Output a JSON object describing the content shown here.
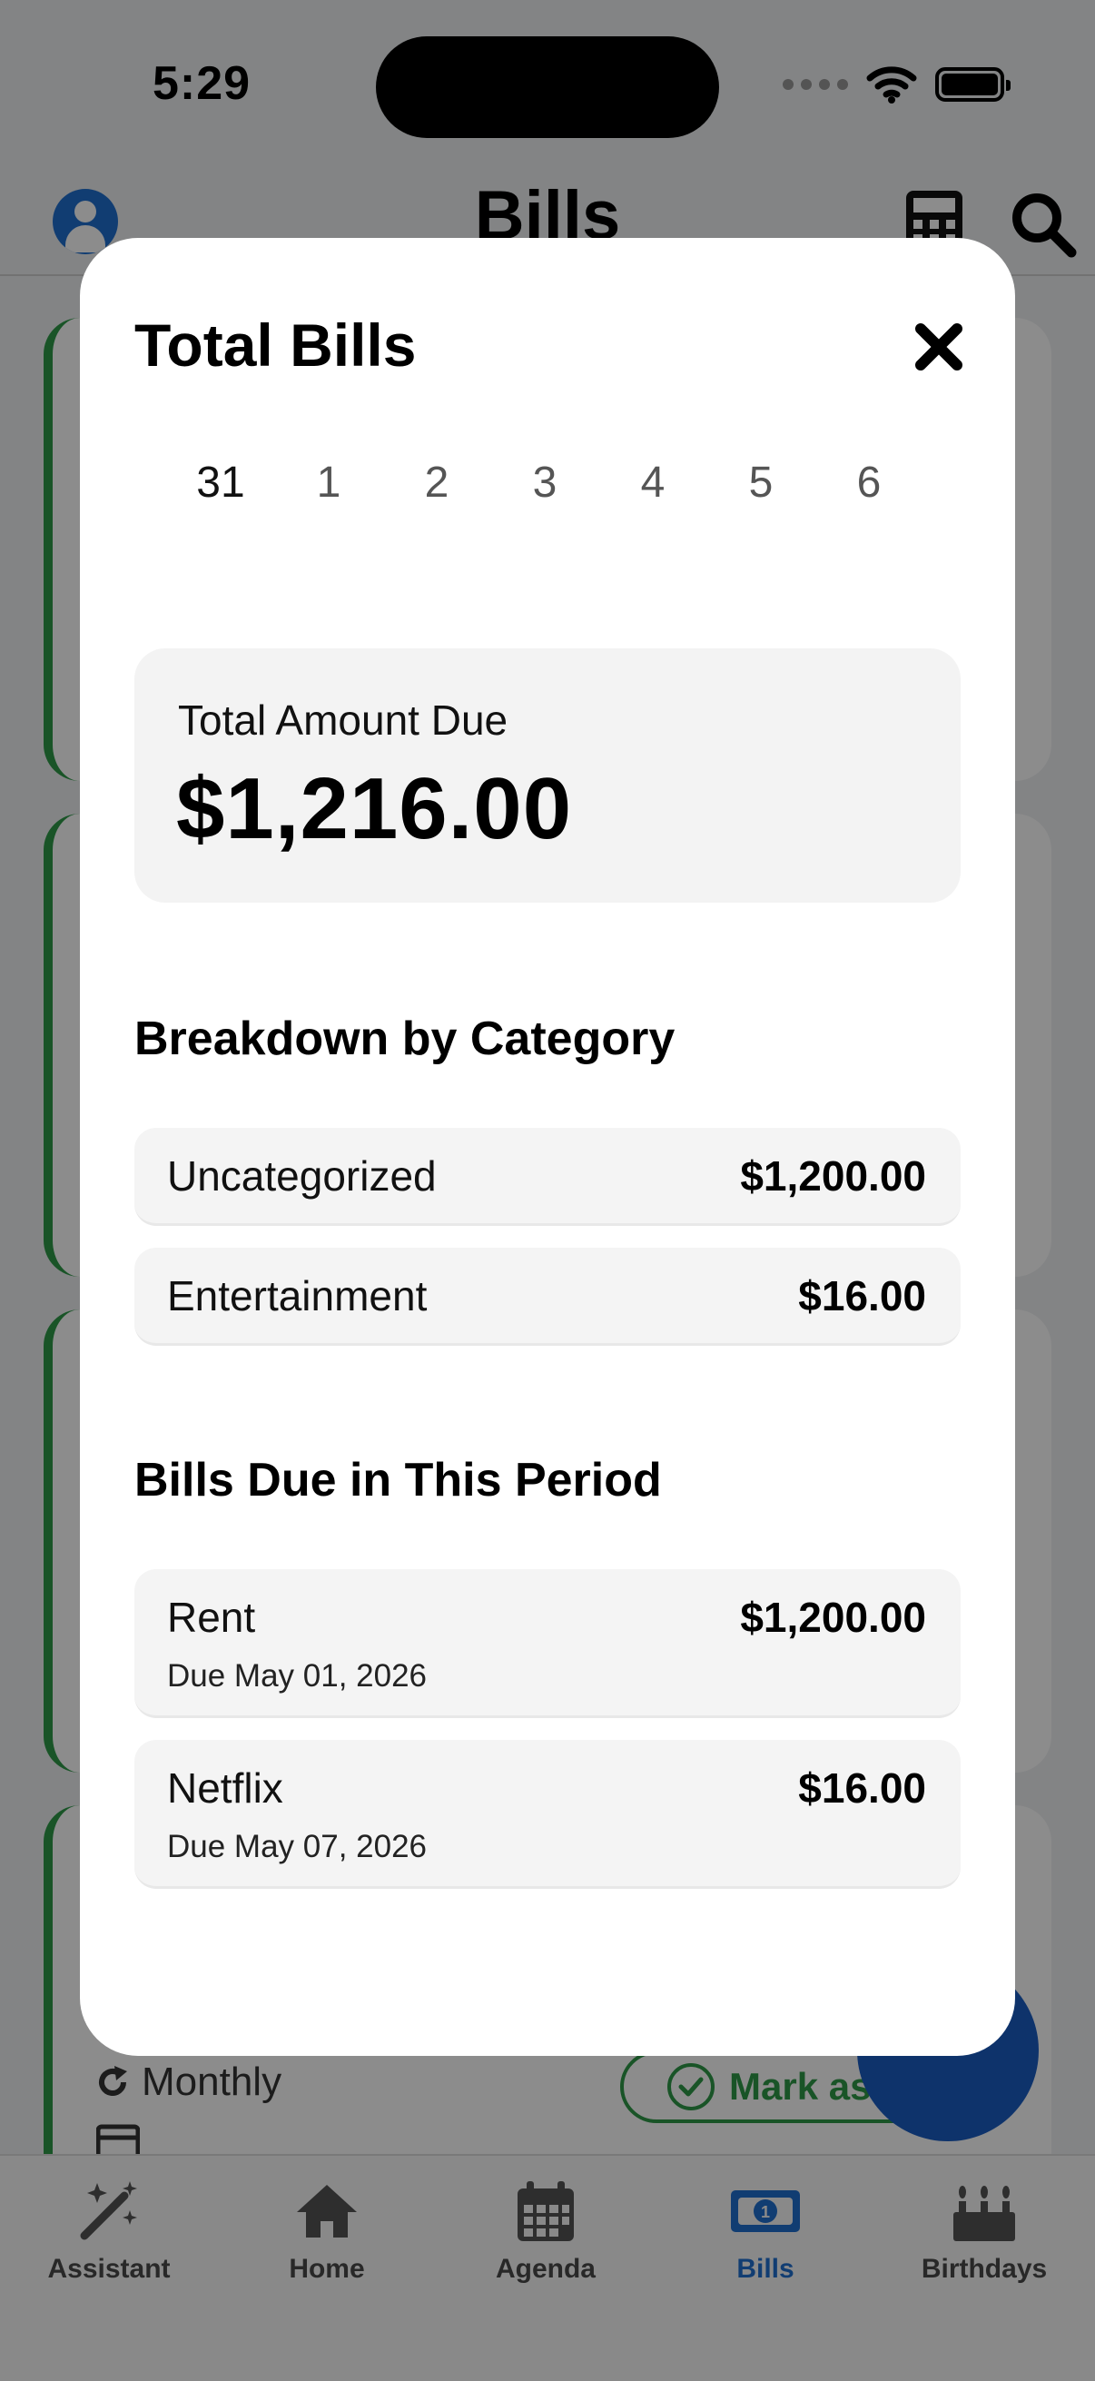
{
  "status_bar": {
    "time": "5:29"
  },
  "header": {
    "title": "Bills"
  },
  "background": {
    "recurrence": "Monthly",
    "mark_paid_label": "Mark as Pa"
  },
  "tabs": [
    {
      "label": "Assistant",
      "icon": "magic-wand-icon",
      "active": false
    },
    {
      "label": "Home",
      "icon": "home-icon",
      "active": false
    },
    {
      "label": "Agenda",
      "icon": "calendar-icon",
      "active": false
    },
    {
      "label": "Bills",
      "icon": "money-bill-icon",
      "active": true
    },
    {
      "label": "Birthdays",
      "icon": "birthday-cake-icon",
      "active": false
    }
  ],
  "modal": {
    "title": "Total Bills",
    "dates": [
      "31",
      "1",
      "2",
      "3",
      "4",
      "5",
      "6"
    ],
    "selected_date": "31",
    "total": {
      "label": "Total Amount Due",
      "value": "$1,216.00"
    },
    "breakdown": {
      "title": "Breakdown by Category",
      "items": [
        {
          "name": "Uncategorized",
          "amount": "$1,200.00"
        },
        {
          "name": "Entertainment",
          "amount": "$16.00"
        }
      ]
    },
    "bills": {
      "title": "Bills Due in This Period",
      "items": [
        {
          "name": "Rent",
          "amount": "$1,200.00",
          "due": "Due May 01, 2026"
        },
        {
          "name": "Netflix",
          "amount": "$16.00",
          "due": "Due May 07, 2026"
        }
      ]
    }
  },
  "colors": {
    "accent_blue": "#1f6fd0",
    "paid_green": "#2e9a48",
    "overlay": "rgba(0,0,0,0.45)"
  }
}
